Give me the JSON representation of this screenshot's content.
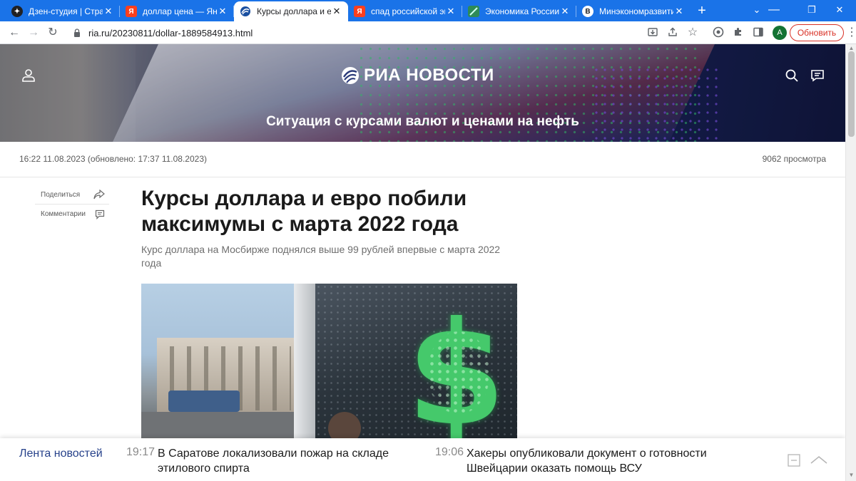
{
  "browser": {
    "tabs": [
      {
        "title": "Дзен-студия | Страсти",
        "favicon": "dzen-icon",
        "color": "#202124",
        "active": false
      },
      {
        "title": "доллар цена — Яндекс",
        "favicon": "yandex-icon",
        "color": "#fc3f1d",
        "active": false
      },
      {
        "title": "Курсы доллара и евро",
        "favicon": "ria-icon",
        "color": "#1a73e8",
        "active": true
      },
      {
        "title": "спад российской экон",
        "favicon": "yandex-icon",
        "color": "#fc3f1d",
        "active": false
      },
      {
        "title": "Экономика России в",
        "favicon": "stats-icon",
        "color": "#2e8b57",
        "active": false
      },
      {
        "title": "Минэкономразвития",
        "favicon": "b-icon",
        "color": "#202124",
        "active": false
      }
    ],
    "url": "ria.ru/20230811/dollar-1889584913.html",
    "update_label": "Обновить",
    "avatar_letter": "A"
  },
  "site": {
    "logo_text": "РИА НОВОСТИ",
    "hero_caption": "Ситуация с курсами валют и ценами на нефть"
  },
  "article": {
    "published": "16:22 11.08.2023",
    "updated": "(обновлено: 17:37 11.08.2023)",
    "views": "9062 просмотра",
    "share_label": "Поделиться",
    "comments_label": "Комментарии",
    "title_line1": "Курсы доллара и евро побили",
    "title_line2": "максимумы с марта 2022 года",
    "lead": "Курс доллара на Мосбирже поднялся выше 99 рублей впервые с марта 2022 года"
  },
  "ticker": {
    "label": "Лента новостей",
    "items": [
      {
        "time": "19:17",
        "text": "В Саратове локализовали пожар на складе этилового спирта"
      },
      {
        "time": "19:06",
        "text": "Хакеры опубликовали документ о готовности Швейцарии оказать помощь ВСУ"
      }
    ]
  }
}
